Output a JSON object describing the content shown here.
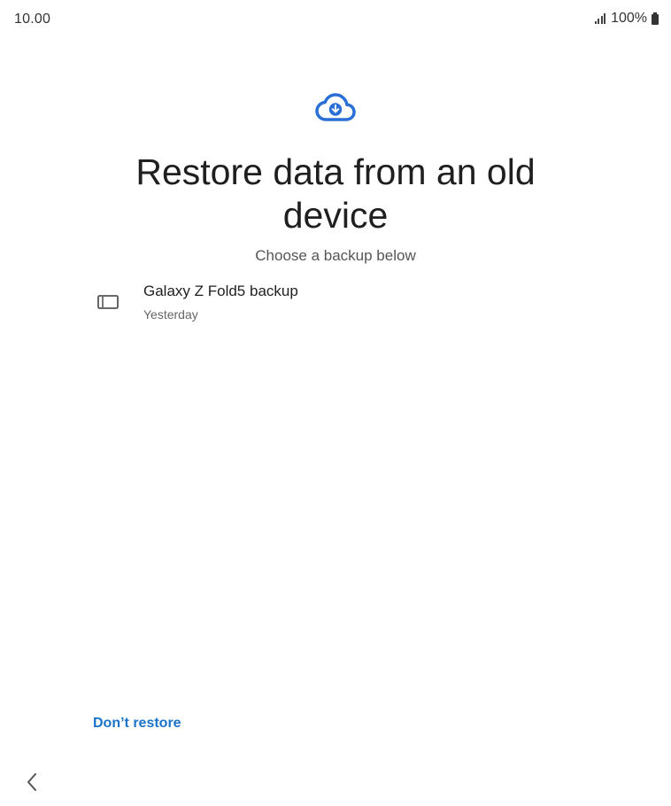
{
  "status_bar": {
    "time": "10.00",
    "battery_text": "100%",
    "icons": [
      "signal-icon",
      "battery-icon"
    ]
  },
  "header": {
    "icon": "cloud-download-icon",
    "title": "Restore data from an old device",
    "subtitle": "Choose a backup below"
  },
  "backups": [
    {
      "icon": "device-icon",
      "name": "Galaxy Z Fold5 backup",
      "date": "Yesterday"
    }
  ],
  "actions": {
    "dont_restore_label": "Don’t restore"
  },
  "nav": {
    "back_icon": "chevron-left-icon"
  },
  "colors": {
    "accent": "#1a73c9",
    "cloud": "#2a6fd6",
    "title": "#1f1f1f",
    "subtitle": "#555555"
  }
}
